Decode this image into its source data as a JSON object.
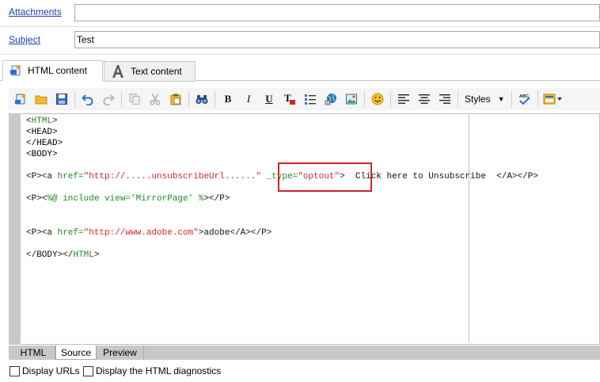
{
  "fields": {
    "attachments_label": "Attachments",
    "attachments_value": "",
    "subject_label": "Subject",
    "subject_value": "Test"
  },
  "tabs": [
    {
      "label": "HTML content",
      "icon": "html-doc-icon",
      "active": true
    },
    {
      "label": "Text content",
      "icon": "letter-a-icon",
      "active": false
    }
  ],
  "toolbar": {
    "bold": "B",
    "italic": "I",
    "underline": "U",
    "styles_label": "Styles"
  },
  "code": {
    "l1": "<HTML>",
    "l2": "<HEAD>",
    "l3": "</HEAD>",
    "l4": "<BODY>",
    "l6_open": "<P><a ",
    "l6_href_kw": "href=",
    "l6_href_val": "\"http://.....unsubscribeUrl......\"",
    "l6_type_kw": " _type=",
    "l6_type_val": "\"optout\"",
    "l6_close": ">  Click here to Unsubscribe  </A></P>",
    "l8_open": "<P><",
    "l8_inc": "%@ include view='MirrorPage' %",
    "l8_close": "></P>",
    "l11_open": "<P><a ",
    "l11_href_kw": "href=",
    "l11_href_val": "\"http://www.adobe.com\"",
    "l11_close": ">adobe</A></P>",
    "l13_a": "</BODY></",
    "l13_kw": "HTML",
    "l13_b": ">"
  },
  "view_tabs": [
    {
      "label": "HTML",
      "active": false
    },
    {
      "label": "Source",
      "active": true
    },
    {
      "label": "Preview",
      "active": false
    }
  ],
  "options": {
    "display_urls": "Display URLs",
    "display_diagnostics": "Display the HTML diagnostics"
  },
  "colors": {
    "link": "#1a3fb5",
    "highlight": "#d0232a",
    "kw_green": "#1f8a1f",
    "attr_red": "#d62728"
  }
}
